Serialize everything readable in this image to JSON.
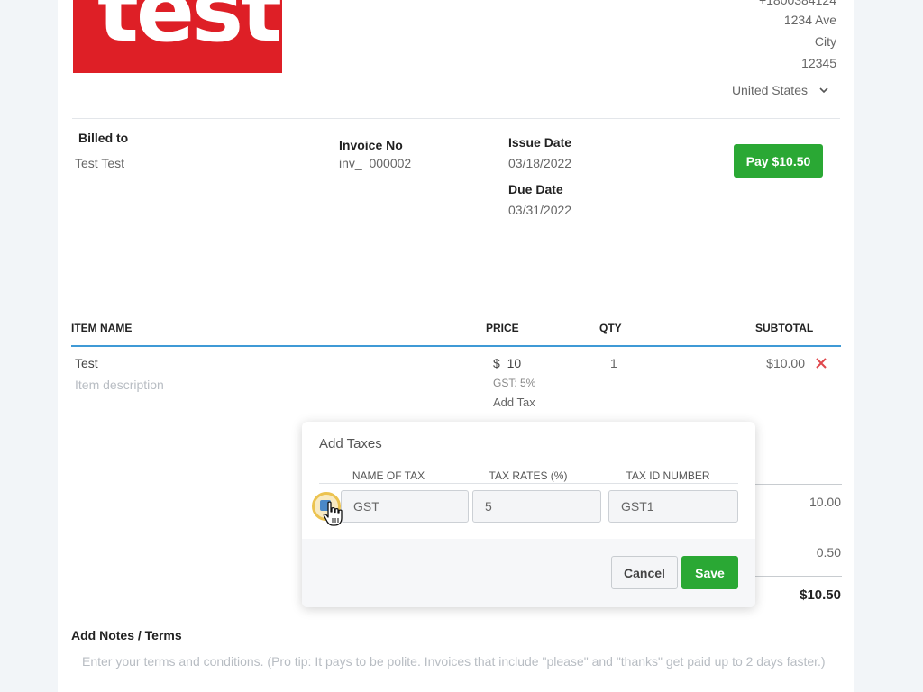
{
  "logo": {
    "text": "test"
  },
  "company": {
    "phone_partial": "+1800384124",
    "street": "1234 Ave",
    "city": "City",
    "zip": "12345",
    "country": "United States"
  },
  "invoice": {
    "billed_to_label": "Billed to",
    "billed_to_value": "Test Test",
    "invoice_no_label": "Invoice No",
    "invoice_no_value": "inv_  000002",
    "issue_date_label": "Issue Date",
    "issue_date_value": "03/18/2022",
    "due_date_label": "Due Date",
    "due_date_value": "03/31/2022",
    "pay_button": "Pay $10.50"
  },
  "items_table": {
    "headers": {
      "item_name": "ITEM NAME",
      "price": "PRICE",
      "qty": "QTY",
      "subtotal": "SUBTOTAL"
    },
    "rows": [
      {
        "name": "Test",
        "description_placeholder": "Item description",
        "price": "$  10",
        "tax_note": "GST: 5%",
        "add_tax": "Add Tax",
        "qty": "1",
        "subtotal": "$10.00"
      }
    ]
  },
  "totals": {
    "subtotal": "10.00",
    "tax": "0.50",
    "total": "$10.50"
  },
  "add_taxes_modal": {
    "title": "Add Taxes",
    "headers": {
      "name": "NAME OF TAX",
      "rate": "TAX RATES (%)",
      "id": "TAX ID NUMBER"
    },
    "row": {
      "name": "GST",
      "rate": "5",
      "id": "GST1"
    },
    "cancel_button": "Cancel",
    "save_button": "Save"
  },
  "notes": {
    "title": "Add Notes / Terms",
    "placeholder": "Enter your terms and conditions. (Pro tip: It pays to be polite. Invoices that include \"please\" and \"thanks\" get paid up to 2 days faster.)"
  },
  "colors": {
    "accent_green": "#2aa834",
    "logo_red": "#de1f26",
    "table_line_blue": "#3f9ad6",
    "remove_red": "#e0474c"
  }
}
